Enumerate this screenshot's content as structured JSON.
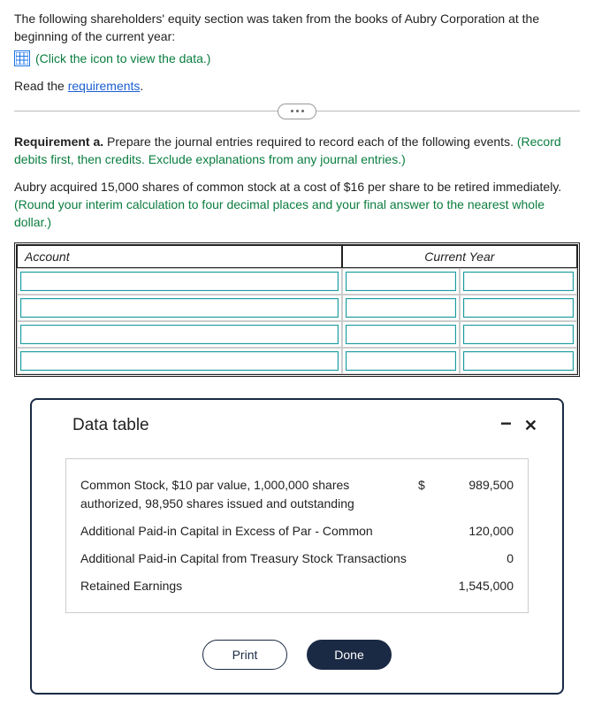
{
  "intro": "The following shareholders' equity section was taken from the books of Aubry Corporation at the beginning of the current year:",
  "data_link_text": "(Click the icon to view the data.)",
  "read_prefix": "Read the ",
  "requirements_link": "requirements",
  "read_suffix": ".",
  "requirement": {
    "label": "Requirement a.",
    "text": " Prepare the journal entries required to record each of the following events. ",
    "note": "(Record debits first, then credits. Exclude explanations from any journal entries.)"
  },
  "event": {
    "text": "Aubry acquired 15,000 shares of common stock at a cost of $16 per share to be retired immediately. ",
    "note": "(Round your interim calculation to four decimal places and your final answer to the nearest whole dollar.)"
  },
  "table": {
    "account_header": "Account",
    "period_header": "Current Year"
  },
  "modal": {
    "title": "Data table",
    "rows": [
      {
        "label": "Common Stock, $10 par value, 1,000,000 shares authorized, 98,950 shares issued and outstanding",
        "currency": "$",
        "value": "989,500"
      },
      {
        "label": "Additional Paid-in Capital in Excess of Par - Common",
        "currency": "",
        "value": "120,000"
      },
      {
        "label": "Additional Paid-in Capital from Treasury Stock Transactions",
        "currency": "",
        "value": "0"
      },
      {
        "label": "Retained Earnings",
        "currency": "",
        "value": "1,545,000"
      }
    ],
    "print": "Print",
    "done": "Done"
  }
}
